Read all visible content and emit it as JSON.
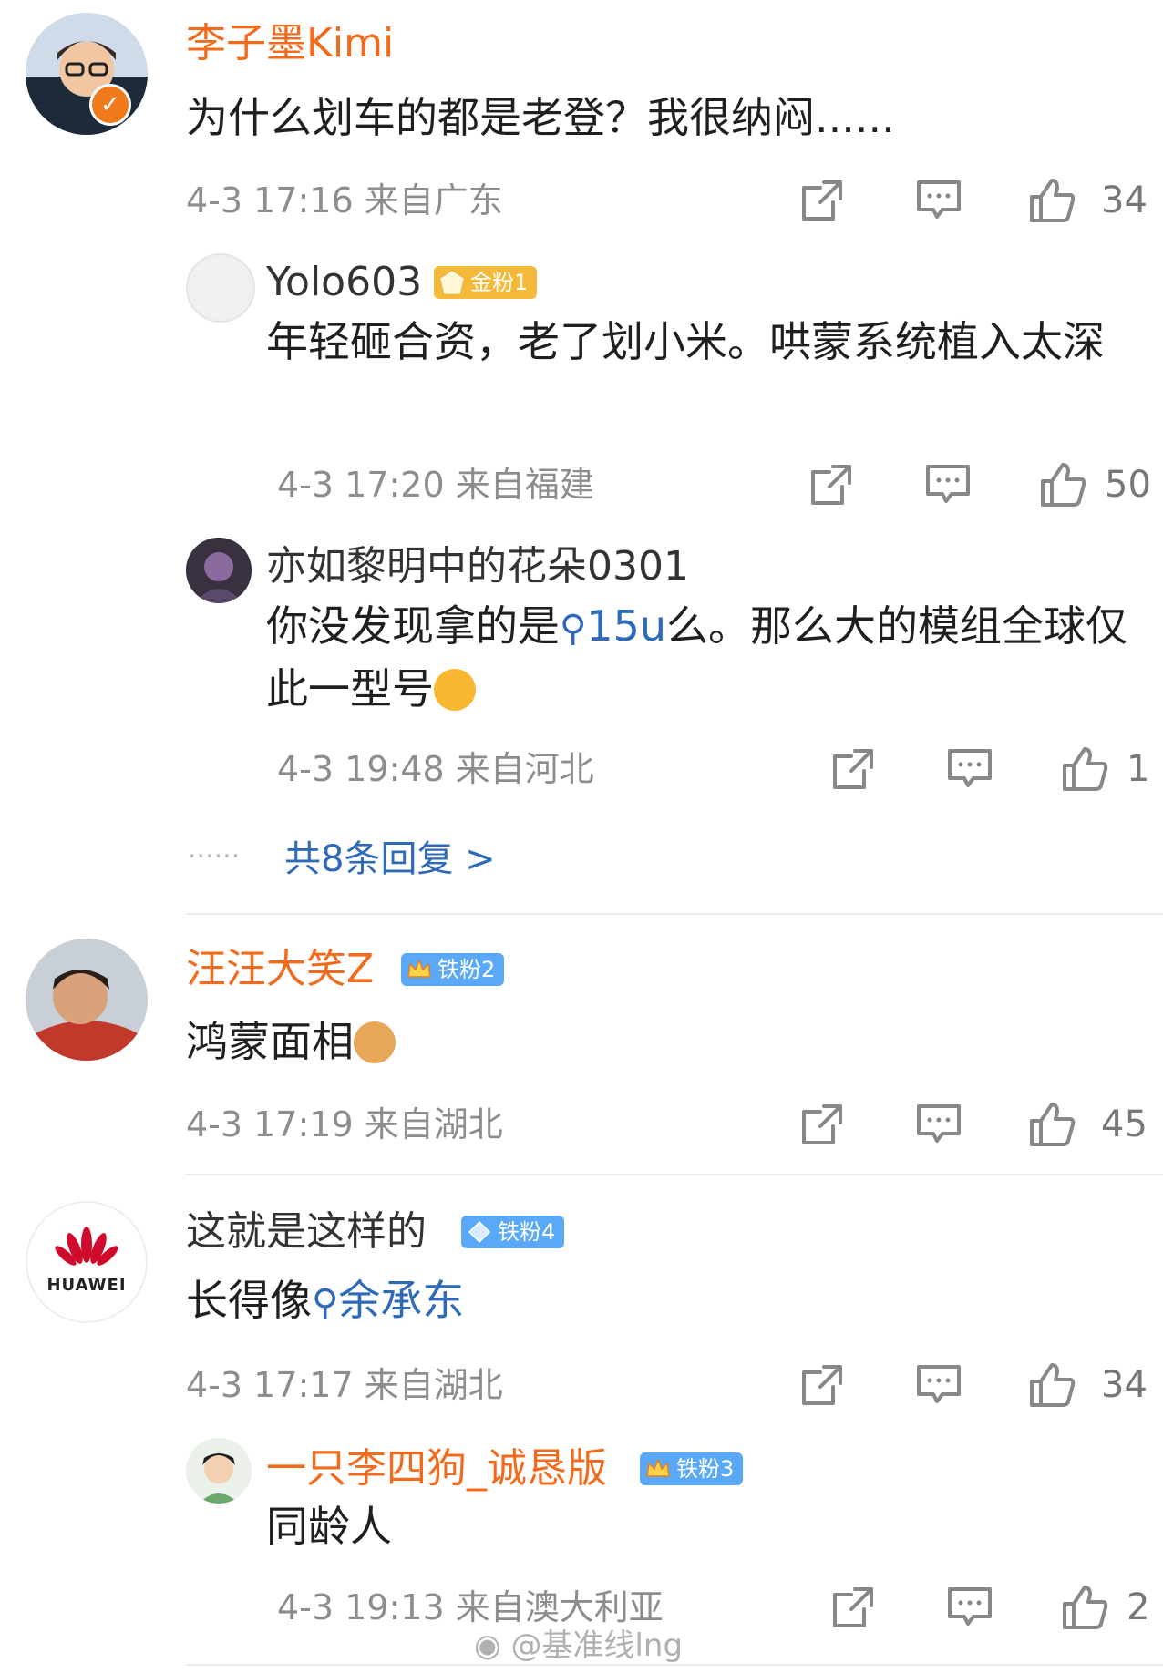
{
  "comments": [
    {
      "user": "李子墨Kimi",
      "text": "为什么划车的都是老登？我很纳闷......",
      "meta": "4-3 17:16 来自广东",
      "likes": "34",
      "replies": [
        {
          "user": "Yolo603",
          "badge": "金粉1",
          "text": "年轻砸合资，老了划小米。哄蒙系统植入太深",
          "meta": "4-3 17:20 来自福建",
          "likes": "50"
        },
        {
          "user": "亦如黎明中的花朵0301",
          "text_before": "你没发现拿的是",
          "link": "15u",
          "text_after": "么。那么大的模组全球仅此一型号",
          "meta": "4-3 19:48 来自河北",
          "likes": "1"
        }
      ],
      "more_replies": "共8条回复 >",
      "dots": "......"
    },
    {
      "user": "汪汪大笑Z",
      "badge": "铁粉2",
      "text": "鸿蒙面相",
      "meta": "4-3 17:19 来自湖北",
      "likes": "45"
    },
    {
      "user": "这就是这样的",
      "badge": "铁粉4",
      "avatar_text": "HUAWEI",
      "text_before": "长得像",
      "link": "余承东",
      "meta": "4-3 17:17 来自湖北",
      "likes": "34",
      "replies": [
        {
          "user": "一只李四狗_诚恳版",
          "badge": "铁粉3",
          "text": "同龄人",
          "meta": "4-3 19:13 来自澳大利亚",
          "likes": "2"
        }
      ]
    }
  ],
  "watermark": "@基准线lng",
  "colors": {
    "name_orange": "#f26b1d",
    "link_blue": "#2e6ab8",
    "meta_gray": "#8d8d8d"
  }
}
